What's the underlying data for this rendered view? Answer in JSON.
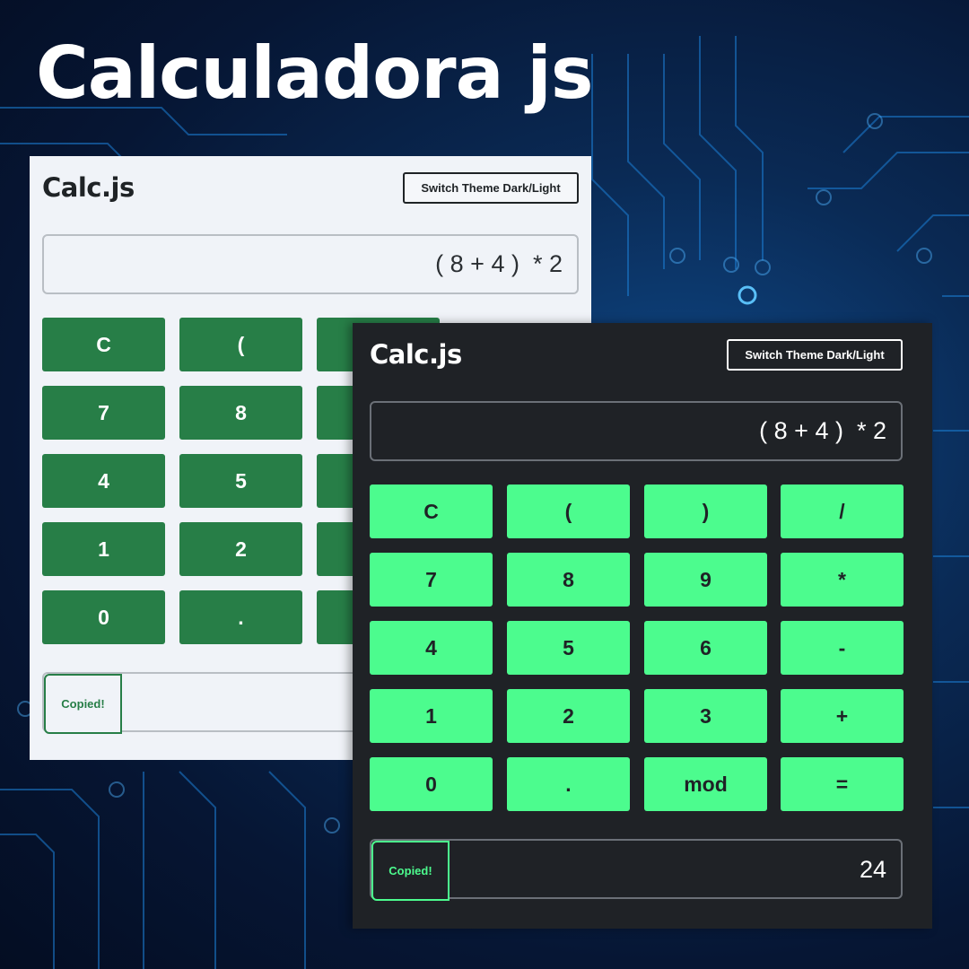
{
  "promo": {
    "title": "Calculadora js"
  },
  "colors": {
    "light_bg": "#f0f3f8",
    "light_key": "#277e47",
    "dark_bg": "#1f2226",
    "dark_key": "#4cfc8e"
  },
  "light_calc": {
    "title": "Calc.js",
    "theme_button": "Switch Theme Dark/Light",
    "display": "( 8 + 4 )  * 2",
    "keys": [
      "C",
      "(",
      "7",
      "8",
      "4",
      "5",
      "1",
      "2",
      "0",
      "."
    ],
    "copied_label": "Copied!"
  },
  "dark_calc": {
    "title": "Calc.js",
    "theme_button": "Switch Theme Dark/Light",
    "display": "( 8 + 4 )  * 2",
    "keys": [
      "C",
      "(",
      ")",
      "/",
      "7",
      "8",
      "9",
      "*",
      "4",
      "5",
      "6",
      "-",
      "1",
      "2",
      "3",
      "+",
      "0",
      ".",
      "mod",
      "="
    ],
    "copied_label": "Copied!",
    "result": "24"
  }
}
